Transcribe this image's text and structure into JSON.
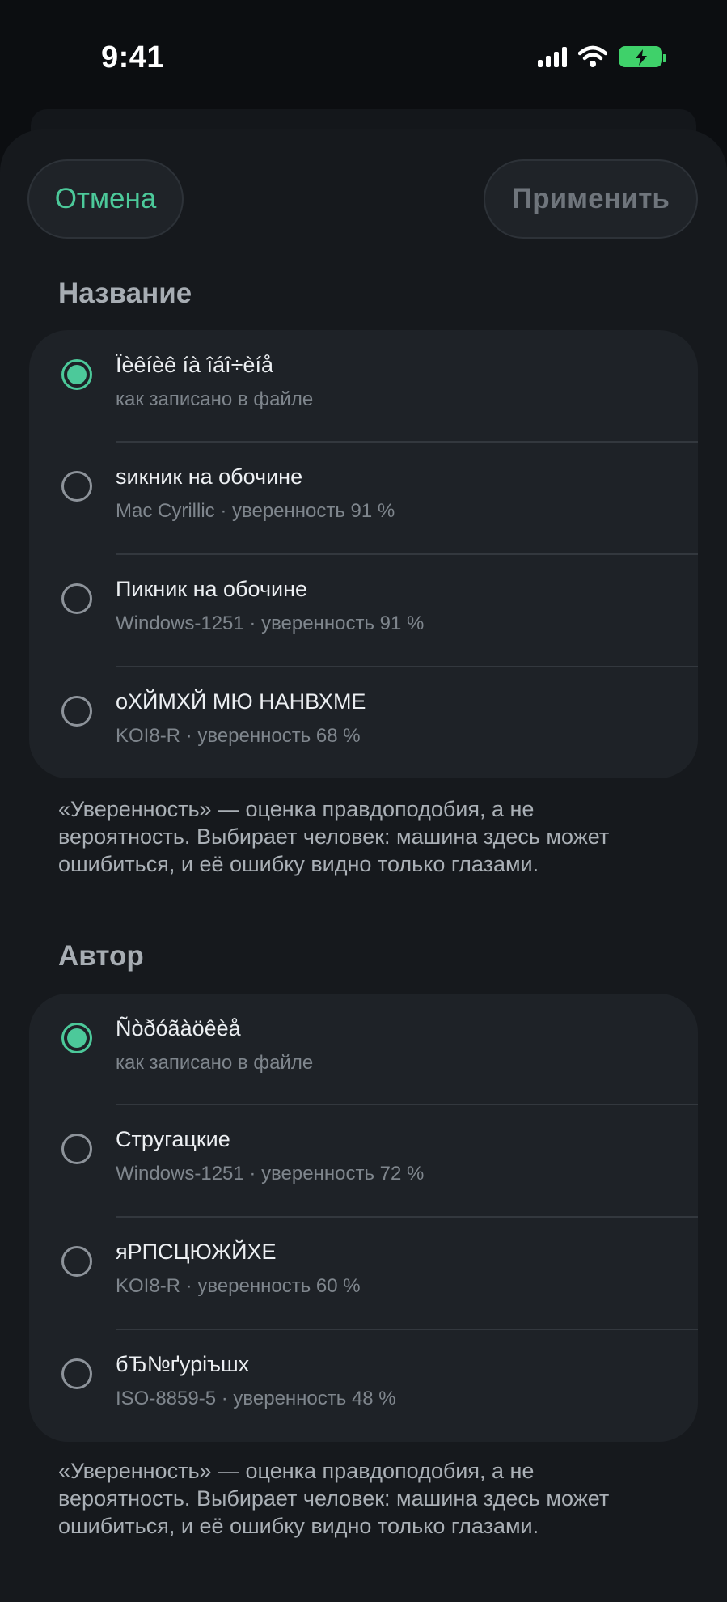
{
  "status_bar": {
    "time": "9:41"
  },
  "toolbar": {
    "cancel_label": "Отмена",
    "apply_label": "Применить"
  },
  "sections": [
    {
      "title": "Название",
      "options": [
        {
          "title": "Ïèêíèê íà îáî÷èíå",
          "subtitle": "как записано в файле",
          "selected": true
        },
        {
          "title": "ѕикник на обочине",
          "subtitle": "Mac Cyrillic · уверенность 91 %",
          "selected": false
        },
        {
          "title": "Пикник на обочине",
          "subtitle": "Windows-1251 · уверенность 91 %",
          "selected": false
        },
        {
          "title": "оХЙМХЙ МЮ НАНВХМЕ",
          "subtitle": "KOI8-R · уверенность 68 %",
          "selected": false
        }
      ],
      "note": "«Уверенность» — оценка правдоподобия, а не вероятность. Выбирает человек: машина здесь может ошибиться, и её ошибку видно только глазами."
    },
    {
      "title": "Автор",
      "options": [
        {
          "title": "Ñòðóãàöêèå",
          "subtitle": "как записано в файле",
          "selected": true
        },
        {
          "title": "Стругацкие",
          "subtitle": "Windows-1251 · уверенность 72 %",
          "selected": false
        },
        {
          "title": "яРПСЦЮЖЙХЕ",
          "subtitle": "KOI8-R · уверенность 60 %",
          "selected": false
        },
        {
          "title": "бЂ№ґуріъшх",
          "subtitle": "ISO-8859-5 · уверенность 48 %",
          "selected": false
        }
      ],
      "note": "«Уверенность» — оценка правдоподобия, а не вероятность. Выбирает человек: машина здесь может ошибиться, и её ошибку видно только глазами."
    }
  ],
  "colors": {
    "accent": "#4cc99a",
    "battery": "#3fd16a",
    "background": "#16191d",
    "card": "#1e2227"
  }
}
